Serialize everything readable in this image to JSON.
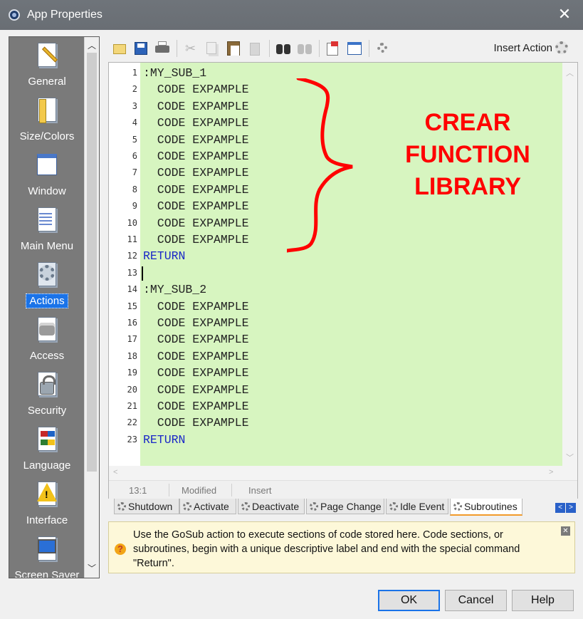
{
  "window": {
    "title": "App Properties"
  },
  "sidebar": {
    "items": [
      {
        "label": "General",
        "icon": "general-icon"
      },
      {
        "label": "Size/Colors",
        "icon": "ruler-icon"
      },
      {
        "label": "Window",
        "icon": "window-icon"
      },
      {
        "label": "Main Menu",
        "icon": "menu-icon"
      },
      {
        "label": "Actions",
        "icon": "gears-icon",
        "selected": true
      },
      {
        "label": "Access",
        "icon": "access-icon"
      },
      {
        "label": "Security",
        "icon": "lock-icon"
      },
      {
        "label": "Language",
        "icon": "language-icon"
      },
      {
        "label": "Interface",
        "icon": "warning-icon"
      },
      {
        "label": "Screen Saver",
        "icon": "monitor-icon"
      }
    ]
  },
  "toolbar": {
    "insert_action_label": "Insert Action"
  },
  "editor": {
    "lines": [
      {
        "n": "1",
        "text": ":MY_SUB_1",
        "kw": false
      },
      {
        "n": "2",
        "text": "  CODE EXPAMPLE",
        "kw": false
      },
      {
        "n": "3",
        "text": "  CODE EXPAMPLE",
        "kw": false
      },
      {
        "n": "4",
        "text": "  CODE EXPAMPLE",
        "kw": false
      },
      {
        "n": "5",
        "text": "  CODE EXPAMPLE",
        "kw": false
      },
      {
        "n": "6",
        "text": "  CODE EXPAMPLE",
        "kw": false
      },
      {
        "n": "7",
        "text": "  CODE EXPAMPLE",
        "kw": false
      },
      {
        "n": "8",
        "text": "  CODE EXPAMPLE",
        "kw": false
      },
      {
        "n": "9",
        "text": "  CODE EXPAMPLE",
        "kw": false
      },
      {
        "n": "10",
        "text": "  CODE EXPAMPLE",
        "kw": false
      },
      {
        "n": "11",
        "text": "  CODE EXPAMPLE",
        "kw": false
      },
      {
        "n": "12",
        "text": "RETURN",
        "kw": true
      },
      {
        "n": "13",
        "text": "",
        "kw": false
      },
      {
        "n": "14",
        "text": ":MY_SUB_2",
        "kw": false
      },
      {
        "n": "15",
        "text": "  CODE EXPAMPLE",
        "kw": false
      },
      {
        "n": "16",
        "text": "  CODE EXPAMPLE",
        "kw": false
      },
      {
        "n": "17",
        "text": "  CODE EXPAMPLE",
        "kw": false
      },
      {
        "n": "18",
        "text": "  CODE EXPAMPLE",
        "kw": false
      },
      {
        "n": "19",
        "text": "  CODE EXPAMPLE",
        "kw": false
      },
      {
        "n": "20",
        "text": "  CODE EXPAMPLE",
        "kw": false
      },
      {
        "n": "21",
        "text": "  CODE EXPAMPLE",
        "kw": false
      },
      {
        "n": "22",
        "text": "  CODE EXPAMPLE",
        "kw": false
      },
      {
        "n": "23",
        "text": "RETURN",
        "kw": true
      }
    ],
    "annotation": [
      "CREAR",
      "FUNCTION",
      "LIBRARY"
    ],
    "annotation_color": "#ff0000",
    "background_color": "#d7f5c0"
  },
  "status": {
    "position": "13:1",
    "modified": "Modified",
    "mode": "Insert"
  },
  "tabs": [
    {
      "label": "Shutdown"
    },
    {
      "label": "Activate"
    },
    {
      "label": "Deactivate"
    },
    {
      "label": "Page Change"
    },
    {
      "label": "Idle Event"
    },
    {
      "label": "Subroutines",
      "active": true
    }
  ],
  "help": {
    "text": "Use the GoSub action to execute sections of code stored here. Code sections, or subroutines, begin with a unique descriptive label and end with the special command \"Return\"."
  },
  "buttons": {
    "ok": "OK",
    "cancel": "Cancel",
    "help": "Help"
  }
}
